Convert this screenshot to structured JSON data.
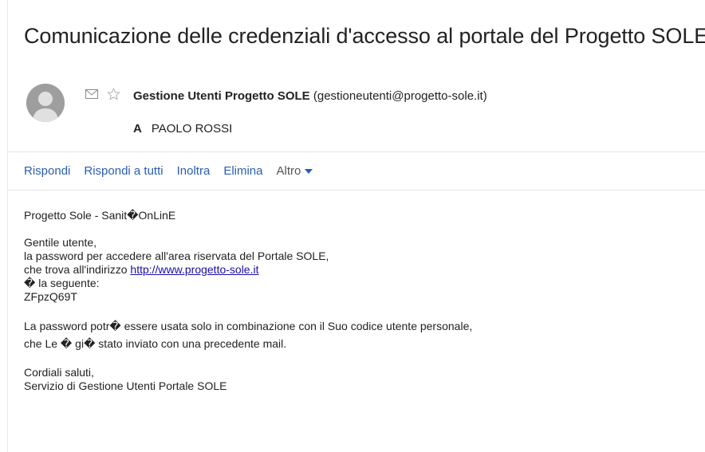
{
  "email": {
    "subject": "Comunicazione delle credenziali d'accesso al portale del Progetto SOLE",
    "sender": {
      "name": "Gestione Utenti Progetto SOLE",
      "email": "(gestioneutenti@progetto-sole.it)"
    },
    "recipient": {
      "label": "A",
      "name": "PAOLO ROSSI"
    }
  },
  "actions": {
    "reply": "Rispondi",
    "reply_all": "Rispondi a tutti",
    "forward": "Inoltra",
    "delete": "Elimina",
    "more": "Altro"
  },
  "body": {
    "header": "Progetto Sole - Sanit�OnLinE",
    "greeting": "Gentile utente,",
    "line1": "la password per accedere all'area riservata del Portale SOLE,",
    "line2_prefix": "che trova all'indirizzo ",
    "link": "http://www.progetto-sole.it",
    "line3": "� la seguente:",
    "password": "ZFpzQ69T",
    "line4": "La password potr� essere usata solo in combinazione con il Suo codice utente personale,",
    "line5": "che Le � gi� stato inviato con una precedente mail.",
    "closing": "Cordiali saluti,",
    "signature": "Servizio di Gestione Utenti Portale SOLE"
  },
  "icons": {
    "avatar": "avatar-icon",
    "envelope": "envelope-icon",
    "star": "star-icon",
    "caret": "caret-down-icon"
  },
  "colors": {
    "link": "#2a5db0",
    "avatar": "#9e9e9e"
  }
}
